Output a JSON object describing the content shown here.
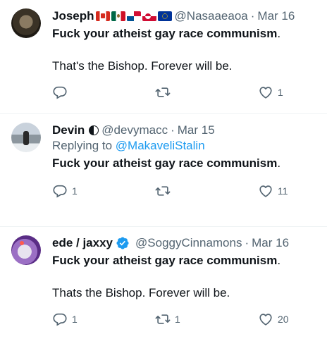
{
  "tweets": [
    {
      "name": "Joseph",
      "handle": "@Nasaaeaoa",
      "date": "Mar 16",
      "replying_prefix": "",
      "replying_to": "",
      "text_bold": "Fuck your atheist gay race communism",
      "text_bold_tail": ".",
      "text_second": "That's the Bishop. Forever will be.",
      "reply_count": "",
      "retweet_count": "",
      "like_count": "1"
    },
    {
      "name": "Devin",
      "handle": "@devymacc",
      "date": "Mar 15",
      "replying_prefix": "Replying to ",
      "replying_to": "@MakaveliStalin",
      "text_bold": "Fuck your atheist gay race communism",
      "text_bold_tail": ".",
      "text_second": "",
      "reply_count": "1",
      "retweet_count": "",
      "like_count": "11"
    },
    {
      "name": "ede / jaxxy",
      "handle": "@SoggyCinnamons",
      "date": "Mar 16",
      "replying_prefix": "",
      "replying_to": "",
      "text_bold": "Fuck your atheist gay race communism",
      "text_bold_tail": ".",
      "text_second": "Thats the Bishop. Forever will be.",
      "reply_count": "1",
      "retweet_count": "1",
      "like_count": "20"
    }
  ],
  "dot": "·",
  "icons": {
    "reply": "reply-icon",
    "retweet": "retweet-icon",
    "like": "heart-icon",
    "verified": "verified-badge-icon"
  },
  "colors": {
    "text": "#0f1419",
    "secondary": "#536471",
    "link": "#1d9bf0",
    "border": "#eff3f4"
  }
}
